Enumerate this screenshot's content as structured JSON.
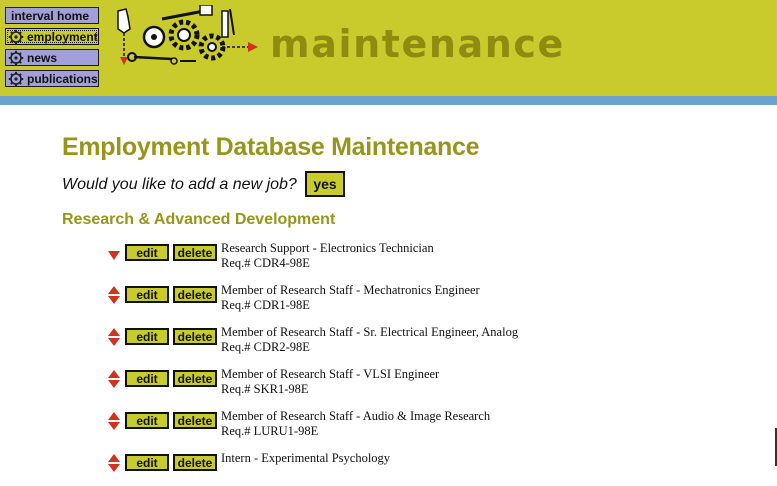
{
  "nav": {
    "home": "interval home",
    "employment": "employment",
    "news": "news",
    "publications": "publications"
  },
  "header": {
    "title": "maintenance"
  },
  "main": {
    "page_title": "Employment Database Maintenance",
    "question": "Would you like to add a new job?",
    "yes_label": "yes",
    "section_title": "Research & Advanced Development",
    "edit_label": "edit",
    "delete_label": "delete",
    "jobs": [
      {
        "title": "Research Support - Electronics Technician",
        "req": "Req.# CDR4-98E"
      },
      {
        "title": "Member of Research Staff - Mechatronics Engineer",
        "req": "Req.# CDR1-98E"
      },
      {
        "title": "Member of Research Staff - Sr. Electrical Engineer, Analog",
        "req": "Req.# CDR2-98E"
      },
      {
        "title": "Member of Research Staff - VLSI Engineer",
        "req": "Req.# SKR1-98E"
      },
      {
        "title": "Member of Research Staff - Audio & Image Research",
        "req": "Req.# LURU1-98E"
      },
      {
        "title": "Intern - Experimental Psychology",
        "req": ""
      }
    ]
  },
  "colors": {
    "header_bg": "#c9ca2b",
    "nav_bg": "#a39fd8",
    "accent_text": "#98961a",
    "blue_bar": "#6aa3cf",
    "arrow_red": "#d0321d"
  },
  "icons": {
    "nav": "gear-icon",
    "move_up": "arrow-up-icon",
    "move_down": "arrow-down-icon",
    "header_art": "machine-gears-icon"
  }
}
